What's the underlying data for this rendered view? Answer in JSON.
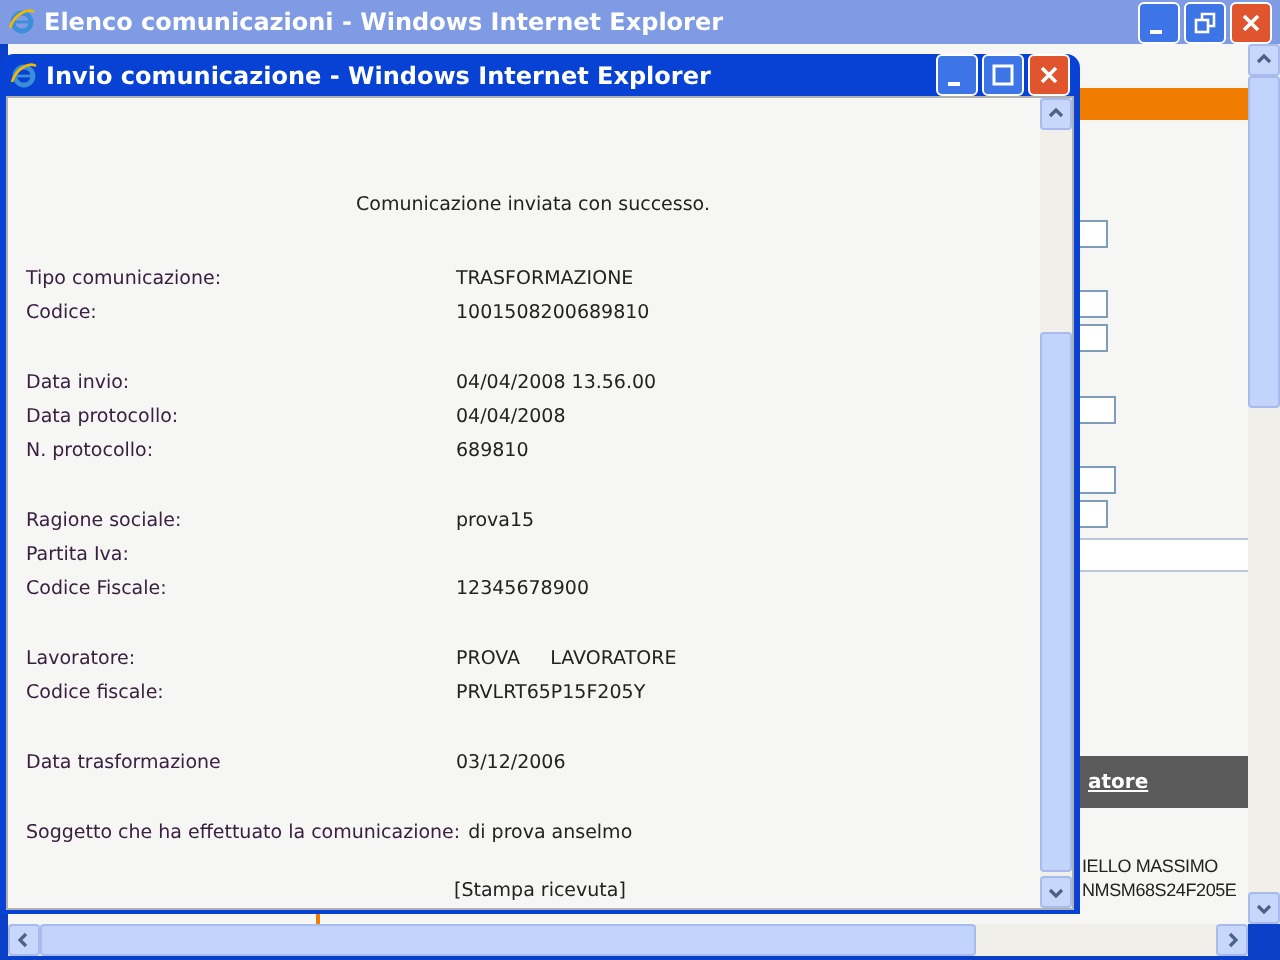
{
  "outer_window": {
    "title": "Elenco comunicazioni - Windows Internet Explorer",
    "page": {
      "column_link": "atore",
      "cells": [
        "IELLO MASSIMO",
        "NMSM68S24F205E"
      ]
    }
  },
  "popup": {
    "title": "Invio comunicazione - Windows Internet Explorer",
    "message": "Comunicazione inviata con successo.",
    "sections": [
      [
        {
          "label": "Tipo comunicazione:",
          "value": "TRASFORMAZIONE"
        },
        {
          "label": "Codice:",
          "value": "1001508200689810"
        }
      ],
      [
        {
          "label": "Data invio:",
          "value": "04/04/2008 13.56.00"
        },
        {
          "label": "Data protocollo:",
          "value": "04/04/2008"
        },
        {
          "label": "N. protocollo:",
          "value": "689810"
        }
      ],
      [
        {
          "label": "Ragione sociale:",
          "value": "prova15"
        },
        {
          "label": "Partita Iva:"
        },
        {
          "label": "Codice Fiscale:",
          "value": "12345678900"
        }
      ],
      [
        {
          "label": "Lavoratore:",
          "value": "PROVA     LAVORATORE"
        },
        {
          "label": "Codice fiscale:",
          "value": "PRVLRT65P15F205Y"
        }
      ],
      [
        {
          "label": "Data trasformazione",
          "value": "03/12/2006"
        }
      ],
      [
        {
          "label": "Soggetto che ha effettuato la comunicazione:",
          "value": "di prova anselmo"
        }
      ]
    ],
    "print_link": "[Stampa ricevuta]"
  }
}
